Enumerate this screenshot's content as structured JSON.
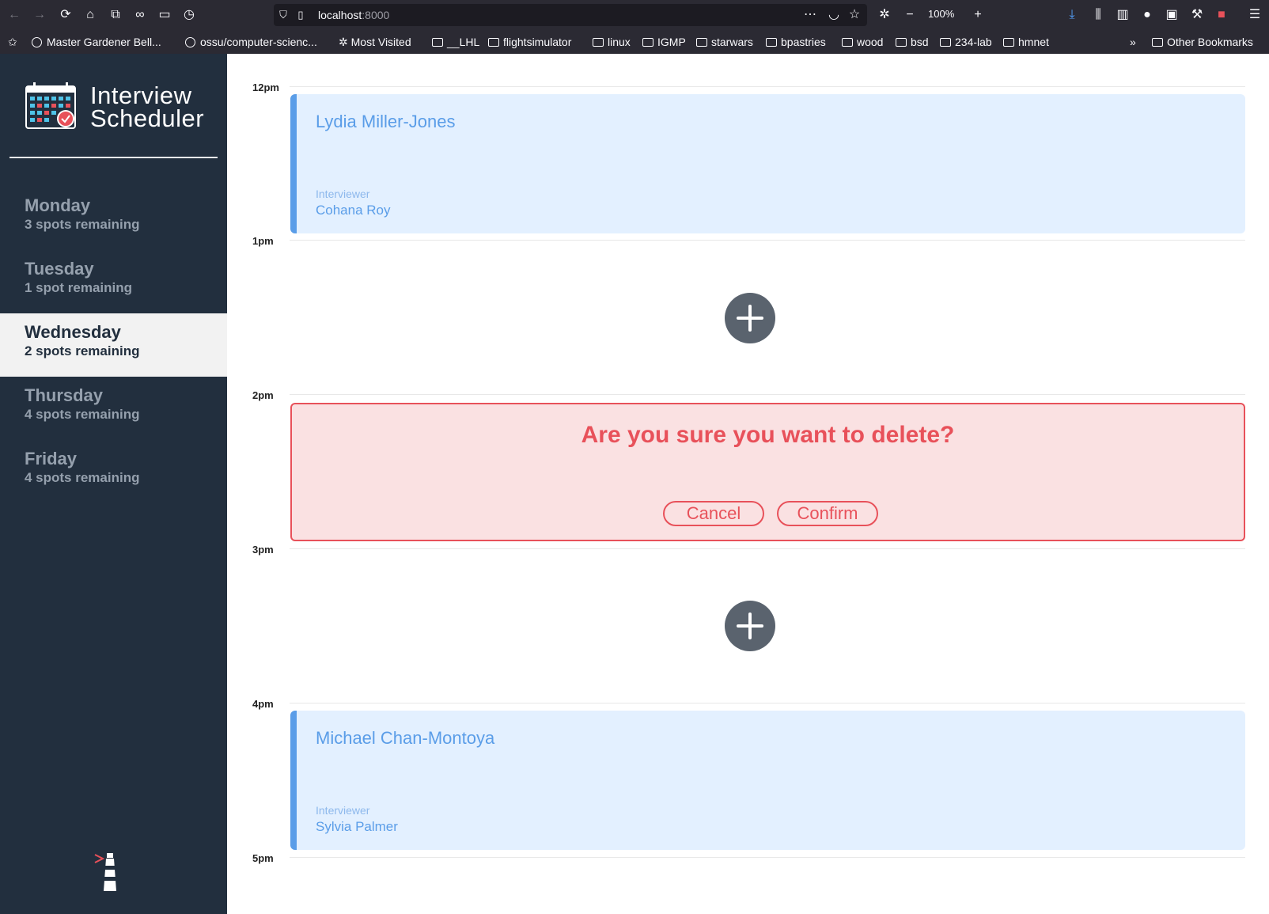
{
  "browser": {
    "url_host": "localhost",
    "url_port": ":8000",
    "zoom": "100%",
    "bookmarks": [
      "Master Gardener Bell...",
      "ossu/computer-scienc...",
      "Most Visited",
      "__LHL",
      "flightsimulator",
      "linux",
      "IGMP",
      "starwars",
      "bpastries",
      "wood",
      "bsd",
      "234-lab",
      "hmnet",
      "Other Bookmarks"
    ]
  },
  "app": {
    "title_line1": "Interview",
    "title_line2": "Scheduler"
  },
  "days": [
    {
      "name": "Monday",
      "spots": "3 spots remaining"
    },
    {
      "name": "Tuesday",
      "spots": "1 spot remaining"
    },
    {
      "name": "Wednesday",
      "spots": "2 spots remaining"
    },
    {
      "name": "Thursday",
      "spots": "4 spots remaining"
    },
    {
      "name": "Friday",
      "spots": "4 spots remaining"
    }
  ],
  "selected_day": "Wednesday",
  "times": [
    "12pm",
    "1pm",
    "2pm",
    "3pm",
    "4pm",
    "5pm"
  ],
  "appointments": [
    {
      "time": "12pm",
      "student": "Lydia Miller-Jones",
      "interviewer_label": "Interviewer",
      "interviewer": "Cohana Roy"
    },
    {
      "time": "4pm",
      "student": "Michael Chan-Montoya",
      "interviewer_label": "Interviewer",
      "interviewer": "Sylvia Palmer"
    }
  ],
  "confirm": {
    "message": "Are you sure you want to delete?",
    "cancel_label": "Cancel",
    "confirm_label": "Confirm"
  },
  "colors": {
    "sidebar_bg": "#222f3e",
    "appointment_bg": "#e3f0ff",
    "appointment_accent": "#5a9de8",
    "danger": "#e8515a",
    "danger_bg": "#fae1e2",
    "add_button": "#5a636e"
  }
}
